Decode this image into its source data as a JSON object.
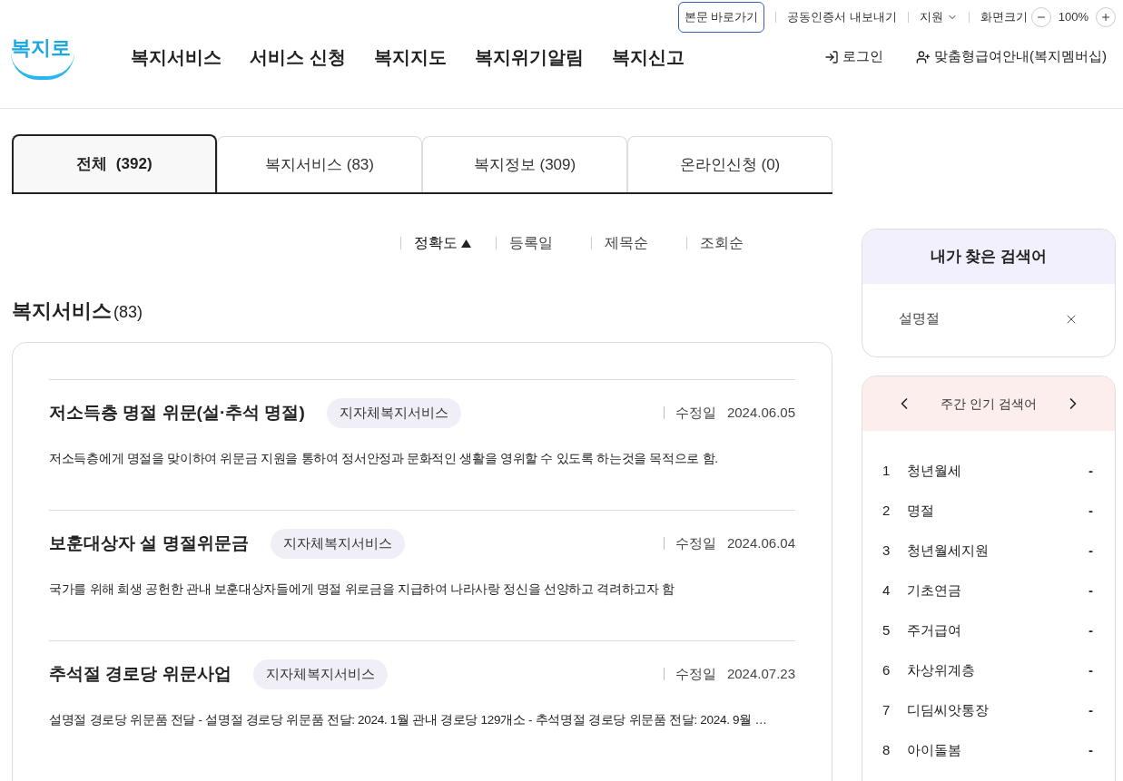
{
  "utility_bar": {
    "skip_link": "본문 바로가기",
    "links": [
      "공동인증서 내보내기",
      "지원"
    ],
    "zoom_label": "화면크기",
    "zoom_value": "100%"
  },
  "header": {
    "logo": "복지로",
    "nav": [
      "복지서비스",
      "서비스 신청",
      "복지지도",
      "복지위기알림",
      "복지신고"
    ],
    "login": "로그인",
    "membership": "맞춤형급여안내(복지멤버십)"
  },
  "tabs": [
    {
      "label": "전체  (392)",
      "selected": true
    },
    {
      "label": "복지서비스 (83)",
      "selected": false
    },
    {
      "label": "복지정보 (309)",
      "selected": false
    },
    {
      "label": "온라인신청 (0)",
      "selected": false
    }
  ],
  "sort_options": [
    {
      "label": "정확도",
      "selected": true
    },
    {
      "label": "등록일",
      "selected": false
    },
    {
      "label": "제목순",
      "selected": false
    },
    {
      "label": "조회순",
      "selected": false
    }
  ],
  "section": {
    "title": "복지서비스",
    "count": "(83)"
  },
  "results": [
    {
      "title": "저소득층 명절 위문(설·추석 명절)",
      "tag": "지자체복지서비스",
      "date_label": "수정일",
      "date": "2024.06.05",
      "summary": "저소득층에게 명절을 맞이하여 위문금 지원을 통하여 정서안정과 문화적인 생활을 영위할 수 있도록 하는것을 목적으로 함."
    },
    {
      "title": "보훈대상자 설 명절위문금",
      "tag": "지자체복지서비스",
      "date_label": "수정일",
      "date": "2024.06.04",
      "summary": "국가를 위해 희생 공헌한 관내 보훈대상자들에게 명절 위로금을 지급하여 나라사랑 정신을 선양하고 격려하고자 함"
    },
    {
      "title": "추석절 경로당 위문사업",
      "tag": "지자체복지서비스",
      "date_label": "수정일",
      "date": "2024.07.23",
      "summary": "설명절 경로당 위문품 전달 - 설명절 경로당 위문품 전달: 2024. 1월 관내 경로당 129개소 - 추석명절 경로당 위문품 전달: 2024. 9월 …"
    }
  ],
  "my_searches": {
    "title": "내가 찾은 검색어",
    "items": [
      "설명절"
    ]
  },
  "popular": {
    "title": "주간 인기 검색어",
    "items": [
      {
        "rank": "1",
        "term": "청년월세",
        "change": "-"
      },
      {
        "rank": "2",
        "term": "명절",
        "change": "-"
      },
      {
        "rank": "3",
        "term": "청년월세지원",
        "change": "-"
      },
      {
        "rank": "4",
        "term": "기초연금",
        "change": "-"
      },
      {
        "rank": "5",
        "term": "주거급여",
        "change": "-"
      },
      {
        "rank": "6",
        "term": "차상위계층",
        "change": "-"
      },
      {
        "rank": "7",
        "term": "디딤씨앗통장",
        "change": "-"
      },
      {
        "rank": "8",
        "term": "아이돌봄",
        "change": "-"
      }
    ]
  }
}
